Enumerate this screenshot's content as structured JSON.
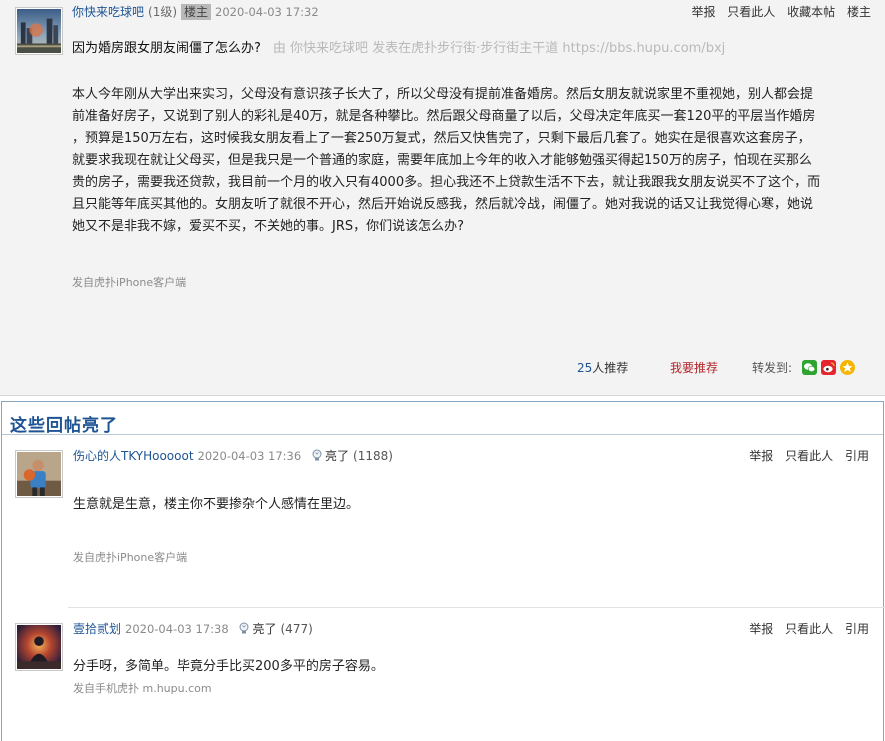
{
  "op": {
    "username": "你快来吃球吧",
    "level": "(1级)",
    "badge": "楼主",
    "time": "2020-04-03 17:32",
    "actions": [
      "举报",
      "只看此人",
      "收藏本帖",
      "楼主"
    ],
    "title": "因为婚房跟女朋友闹僵了怎么办?",
    "title_source": "由 你快来吃球吧 发表在虎扑步行街·步行街主干道 https://bbs.hupu.com/bxj",
    "body_lines": [
      "本人今年刚从大学出来实习，父母没有意识孩子长大了，所以父母没有提前准备婚房。然后女朋友就说家里不重视她，别人都会提",
      "前准备好房子，又说到了别人的彩礼是40万，就是各种攀比。然后跟父母商量了以后，父母决定年底买一套120平的平层当作婚房",
      "，预算是150万左右，这时候我女朋友看上了一套250万复式，然后又快售完了，只剩下最后几套了。她实在是很喜欢这套房子，",
      "就要求我现在就让父母买，但是我只是一个普通的家庭，需要年底加上今年的收入才能够勉强买得起150万的房子，怕现在买那么",
      "贵的房子，需要我还贷款，我目前一个月的收入只有4000多。担心我还不上贷款生活不下去，就让我跟我女朋友说买不了这个，而",
      "且只能等年底买其他的。女朋友听了就很不开心，然后开始说反感我，然后就冷战，闹僵了。她对我说的话又让我觉得心寒，她说",
      "她又不是非我不嫁，爱买不买，不关她的事。JRS，你们说该怎么办?"
    ],
    "client": "发自虎扑iPhone客户端",
    "recommend_count": "25",
    "recommend_suffix": "人推荐",
    "recommend_button": "我要推荐",
    "share_label": "转发到:",
    "share_icons": [
      "wechat-icon",
      "weibo-icon",
      "qzone-icon"
    ]
  },
  "lit": {
    "title": "这些回帖亮了",
    "replies": [
      {
        "username": "伤心的人TKYHooooot",
        "time": "2020-04-03 17:36",
        "light_label": "亮了",
        "light_count": "(1188)",
        "actions": [
          "举报",
          "只看此人",
          "引用"
        ],
        "text": "生意就是生意，楼主你不要掺杂个人感情在里边。",
        "client": "发自虎扑iPhone客户端"
      },
      {
        "username": "壹拾贰划",
        "time": "2020-04-03 17:38",
        "light_label": "亮了",
        "light_count": "(477)",
        "actions": [
          "举报",
          "只看此人",
          "引用"
        ],
        "text": "分手呀，多简单。毕竟分手比买200多平的房子容易。",
        "client": "发自手机虎扑 m.hupu.com"
      }
    ]
  },
  "colors": {
    "link_blue": "#1e5494",
    "recommend_red": "#b0262b",
    "op_background": "#f3f3f3",
    "lit_border": "#88a6bf"
  }
}
